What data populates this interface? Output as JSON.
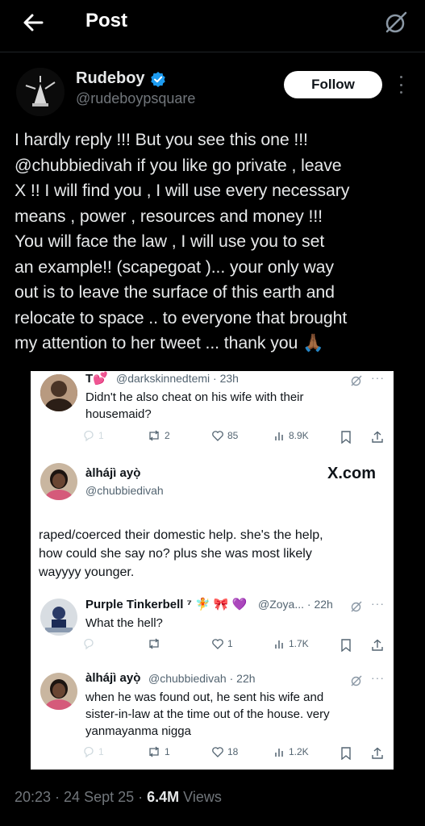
{
  "header": {
    "title": "Post",
    "back_icon": "arrow-left-icon",
    "grok_icon": "grok-icon"
  },
  "author": {
    "name": "Rudeboy",
    "handle": "@rudeboypsquare",
    "verified": true,
    "verified_color": "#1d9bf0",
    "follow_label": "Follow"
  },
  "tweet": {
    "lines": [
      "I hardly reply !!! But you see this one !!!",
      " @chubbiedivah  if you like go private , leave",
      "X !! I will find you , I will use every necessary",
      "means , power , resources and money !!!",
      "You will face the law , I will use you to set",
      "an example!! (scapegoat )... your only way",
      "out is to leave the surface of this earth and",
      "relocate to space .. to everyone that brought",
      "my attention to her tweet ... thank you 🙏🏾"
    ]
  },
  "screenshot": {
    "watermark": "X.com",
    "reply1": {
      "name": "T💕",
      "handle": "@darkskinnedtemi · 23h",
      "text_lines": [
        "Didn't he also cheat on his wife with their",
        "housemaid?"
      ],
      "reply_count": "1",
      "repost_count": "2",
      "like_count": "85",
      "view_count": "8.9K"
    },
    "main": {
      "name": "àlhájì ayọ̀",
      "handle": "@chubbiedivah",
      "text_lines": [
        "raped/coerced their domestic help. she's the help,",
        "how could she say no? plus she was most likely",
        "wayyyy younger."
      ]
    },
    "reply2": {
      "name": "Purple Tinkerbell ⁷ 🧚 🎀 💜",
      "handle": "@Zoya... · 22h",
      "text_lines": [
        "What the hell?"
      ],
      "reply_count": "",
      "repost_count": "",
      "like_count": "1",
      "view_count": "1.7K"
    },
    "reply3": {
      "name": "àlhájì ayọ̀",
      "handle": "@chubbiedivah · 22h",
      "text_lines": [
        "when he was found out, he sent his wife and",
        "sister-in-law at the time out of the house.  very",
        "yanmayanma nigga"
      ],
      "reply_count": "1",
      "repost_count": "1",
      "like_count": "18",
      "view_count": "1.2K"
    }
  },
  "footer": {
    "time": "20:23 · 24 Sept 25 · ",
    "views": "6.4M",
    "views_label": " Views"
  }
}
